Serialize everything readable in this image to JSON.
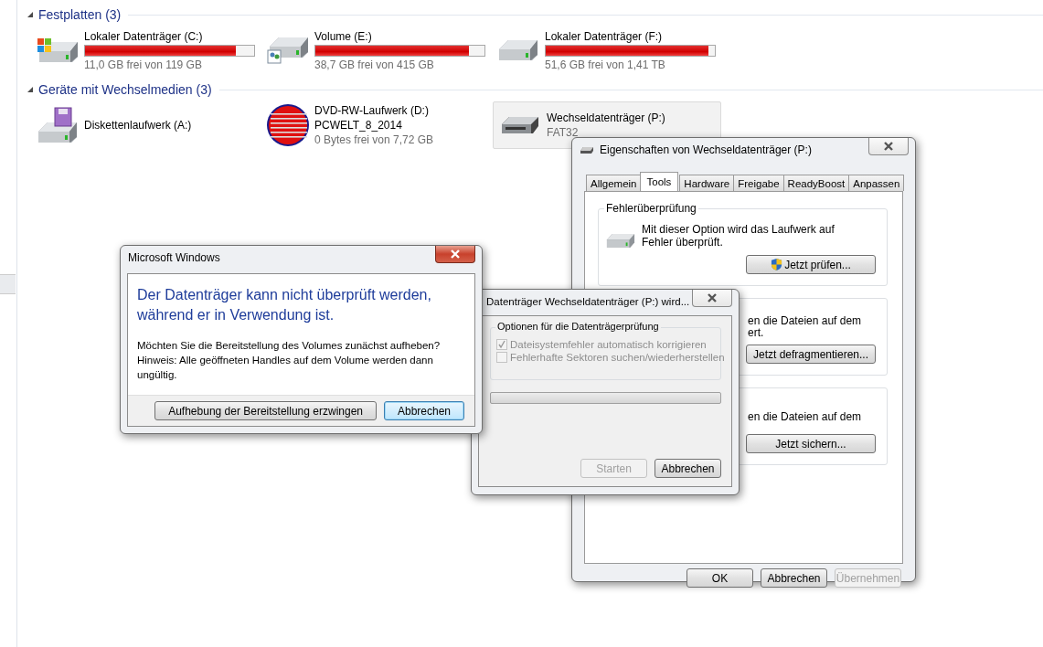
{
  "explorer": {
    "sections": [
      {
        "title": "Festplatten (3)",
        "expanded": true,
        "items": [
          {
            "kind": "system-drive",
            "name": "Lokaler Datenträger (C:)",
            "level": 0.89,
            "lines": [
              "11,0 GB frei von 119 GB"
            ],
            "selected": false
          },
          {
            "kind": "shared-drive",
            "name": "Volume (E:)",
            "level": 0.91,
            "lines": [
              "38,7 GB frei von 415 GB"
            ],
            "selected": false
          },
          {
            "kind": "hard-drive",
            "name": "Lokaler Datenträger (F:)",
            "level": 0.96,
            "lines": [
              "51,6 GB frei von 1,41 TB"
            ],
            "selected": false
          }
        ]
      },
      {
        "title": "Geräte mit Wechselmedien (3)",
        "expanded": true,
        "items": [
          {
            "kind": "floppy",
            "name": "Diskettenlaufwerk (A:)",
            "selected": false
          },
          {
            "kind": "disc",
            "name": "DVD-RW-Laufwerk (D:)",
            "lines": [
              "PCWELT_8_2014",
              "0 Bytes frei von 7,72 GB"
            ],
            "selected": false
          },
          {
            "kind": "removable",
            "name": "Wechseldatenträger (P:)",
            "lines": [
              "FAT32"
            ],
            "selected": true
          }
        ]
      }
    ]
  },
  "properties": {
    "title": "Eigenschaften von Wechseldatenträger (P:)",
    "tabs": [
      {
        "label": "Allgemein",
        "selected": false
      },
      {
        "label": "Tools",
        "selected": true
      },
      {
        "label": "Hardware",
        "selected": false
      },
      {
        "label": "Freigabe",
        "selected": false
      },
      {
        "label": "ReadyBoost",
        "selected": false
      },
      {
        "label": "Anpassen",
        "selected": false
      }
    ],
    "groups": [
      {
        "legend": "Fehlerüberprüfung",
        "text": "Mit dieser Option wird das Laufwerk auf Fehler überprüft.",
        "button": "Jetzt prüfen...",
        "shield": true
      },
      {
        "lines": [
          "en die Dateien auf dem",
          "ert."
        ],
        "button": "Jetzt defragmentieren...",
        "shield": false
      },
      {
        "lines": [
          "en die Dateien auf dem"
        ],
        "button": "Jetzt sichern...",
        "shield": false
      }
    ],
    "buttons": [
      {
        "label": "OK",
        "disabled": false
      },
      {
        "label": "Abbrechen",
        "disabled": false
      },
      {
        "label": "Übernehmen",
        "disabled": true
      }
    ]
  },
  "check_dialog": {
    "title": "Datenträger Wechseldatenträger (P:) wird...",
    "legend": "Optionen für die Datenträgerprüfung",
    "options": [
      {
        "label": "Dateisystemfehler automatisch korrigieren",
        "checked": true,
        "disabled": true
      },
      {
        "label": "Fehlerhafte Sektoren suchen/wiederherstellen",
        "checked": false,
        "disabled": true
      }
    ],
    "progress": {
      "level": 0
    },
    "buttons": [
      {
        "label": "Starten",
        "disabled": true
      },
      {
        "label": "Abbrechen",
        "disabled": false
      }
    ]
  },
  "message_box": {
    "title": "Microsoft Windows",
    "heading": "Der Datenträger kann nicht überprüft werden, während er in Verwendung ist.",
    "body": "Möchten Sie die Bereitstellung des Volumes zunächst aufheben? Hinweis: Alle geöffneten Handles auf dem Volume werden dann ungültig.",
    "buttons": [
      {
        "label": "Aufhebung der Bereitstellung erzwingen",
        "default": false
      },
      {
        "label": "Abbrechen",
        "default": true
      }
    ]
  }
}
